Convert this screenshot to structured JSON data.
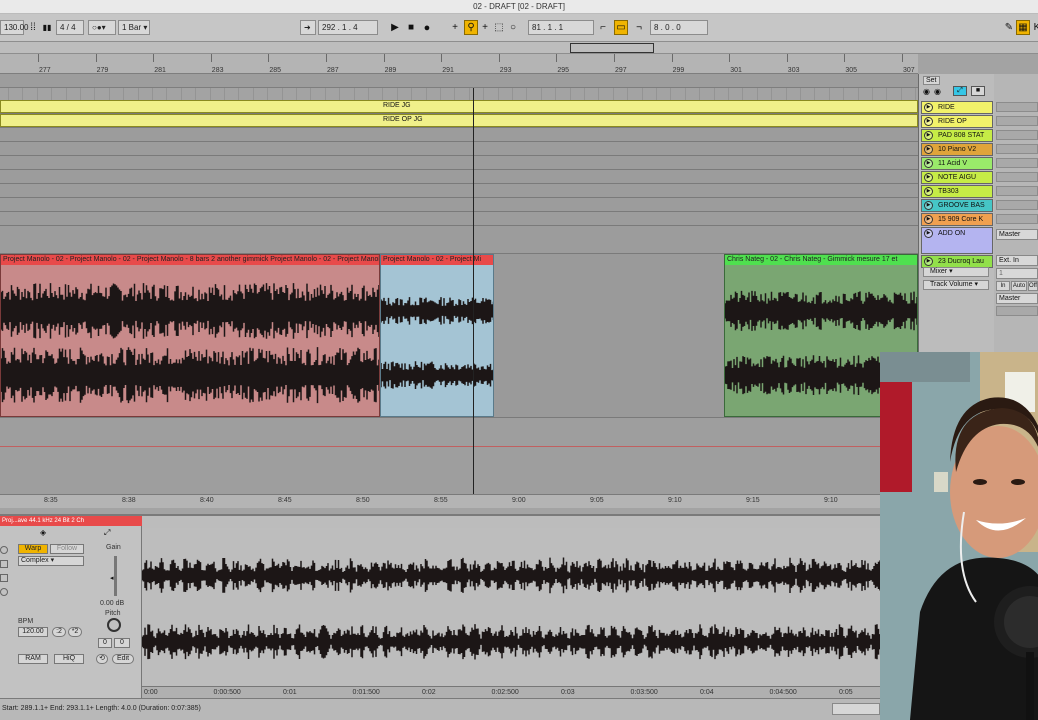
{
  "window": {
    "title": "02 - DRAFT  [02 - DRAFT]"
  },
  "transport": {
    "tempo": "130.00",
    "meter": "4 / 4",
    "quantize": "1 Bar",
    "position": "292 .  1 .  4",
    "loop_start": "81 .  1 .  1",
    "loop_length": "8 .  0 .  0"
  },
  "ruler": {
    "bars": [
      "277",
      "279",
      "281",
      "283",
      "285",
      "287",
      "289",
      "291",
      "293",
      "295",
      "297",
      "299",
      "301",
      "303",
      "305",
      "307"
    ]
  },
  "clips": {
    "ride": "RIDE JG",
    "ride_op": "RIDE OP JG",
    "audio_red": "Project Manolo - 02 - Project Manolo - 02 - Project Manolo - 8 bars 2 another gimmick Project Manolo - 02 - Project Manolo - 02 - Project Ma",
    "audio_blue": "Project Manolo - 02 - Project Mi",
    "audio_green": "Chris Nateg - 02 - Chris Nateg - Gimmick mesure 17 et"
  },
  "time_ruler": {
    "labels": [
      "8:35",
      "8:38",
      "8:40",
      "8:45",
      "8:50",
      "8:55",
      "9:00",
      "9:05",
      "9:10",
      "9:15",
      "9:10"
    ]
  },
  "tracks": [
    {
      "name": "RIDE",
      "color": "#f2f26a"
    },
    {
      "name": "RIDE OP",
      "color": "#f2f26a"
    },
    {
      "name": "PAD 808 STAT",
      "color": "#c6ec46"
    },
    {
      "name": "10 Piano V2",
      "color": "#e0a43a"
    },
    {
      "name": "11 Acid V",
      "color": "#9aea6a"
    },
    {
      "name": "NOTE AIGU",
      "color": "#c6ec46"
    },
    {
      "name": "TB303",
      "color": "#c6ec46"
    },
    {
      "name": "GROOVE BAS",
      "color": "#46c6c6"
    },
    {
      "name": "15 909 Core K",
      "color": "#f0a050"
    },
    {
      "name": "ADD ON",
      "color": "#b4b4f0"
    },
    {
      "name": "23 Ducroq Lau",
      "color": "#92e04a"
    }
  ],
  "set_label": "Set",
  "io": {
    "out1": "Master",
    "ext_in": "Ext. In",
    "ch": "1",
    "master2": "Master",
    "mixer": "Mixer",
    "track_volume": "Track Volume",
    "in": "In",
    "auto": "Auto",
    "off": "Off"
  },
  "detail": {
    "clip_header": "Proj...ave   44.1 kHz 24 Bit 2 Ch",
    "warp": "Warp",
    "follow": "Follow",
    "warp_mode": "Complex",
    "gain_label": "Gain",
    "gain_value": "0.00 dB",
    "pitch_label": "Pitch",
    "pitch_value": "0",
    "pitch_fine": "0",
    "bpm_label": "BPM",
    "bpm_value": "120.00",
    "halve": ":2",
    "double": "*2",
    "ram": "RAM",
    "hiq": "HiQ",
    "edit": "Edit"
  },
  "sample_ruler": {
    "labels": [
      "0:00",
      "0:00:500",
      "0:01",
      "0:01:500",
      "0:02",
      "0:02:500",
      "0:03",
      "0:03:500",
      "0:04",
      "0:04:500",
      "0:05"
    ]
  },
  "status": {
    "text": "Start: 289.1.1+   End: 293.1.1+   Length: 4.0.0 (Duration: 0:07:385)"
  },
  "colors": {
    "midi_clip": "#f0f08a",
    "audio_red": "#c88a8a",
    "audio_blue": "#a4c4d4",
    "audio_green": "#7aa672",
    "waveform": "#1c1616"
  }
}
